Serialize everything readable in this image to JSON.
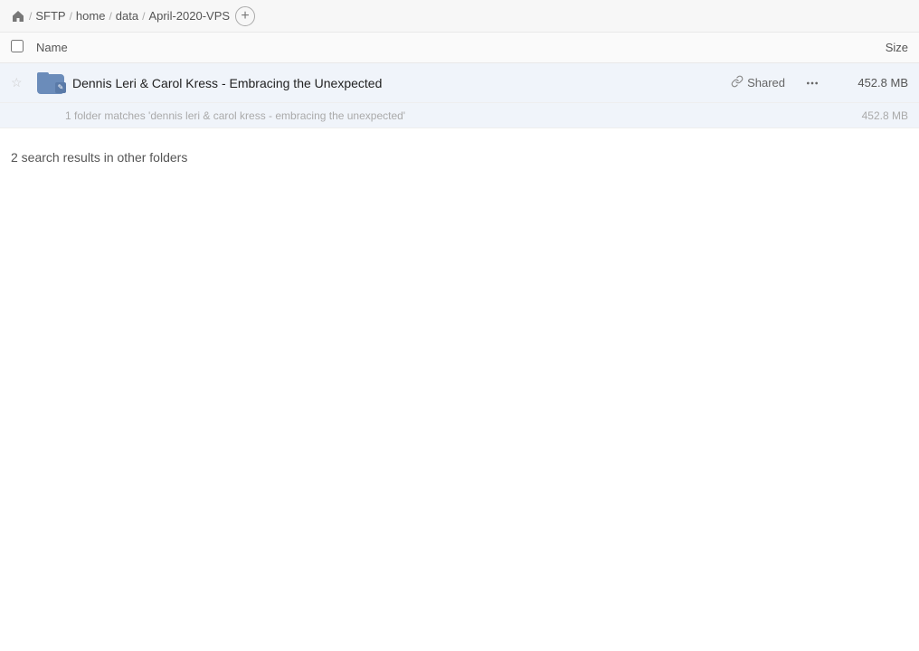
{
  "breadcrumb": {
    "items": [
      {
        "label": "SFTP",
        "id": "sftp"
      },
      {
        "label": "home",
        "id": "home"
      },
      {
        "label": "data",
        "id": "data"
      },
      {
        "label": "April-2020-VPS",
        "id": "april-2020-vps"
      }
    ],
    "add_tab_label": "+"
  },
  "table": {
    "header": {
      "name_label": "Name",
      "size_label": "Size"
    },
    "rows": [
      {
        "id": "row-1",
        "name": "Dennis Leri & Carol Kress - Embracing the Unexpected",
        "shared_label": "Shared",
        "size": "452.8 MB",
        "sub_info": "1 folder matches 'dennis leri & carol kress - embracing the unexpected'",
        "sub_size": "452.8 MB"
      }
    ],
    "other_results_label": "2 search results in other folders"
  },
  "icons": {
    "home": "⌂",
    "link": "🔗",
    "more": "···",
    "star_empty": "☆",
    "pencil": "✎"
  }
}
